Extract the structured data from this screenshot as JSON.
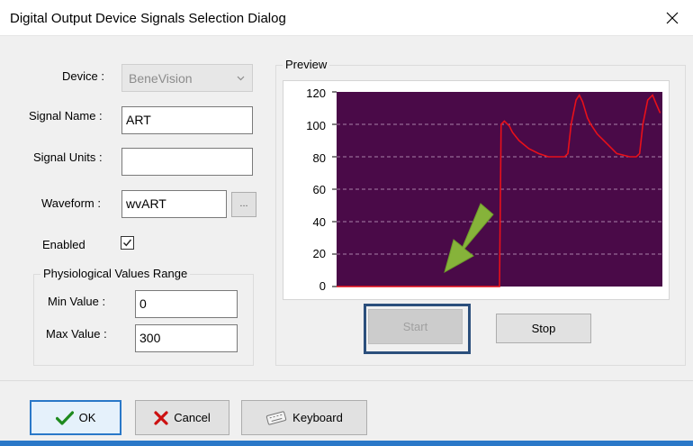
{
  "window": {
    "title": "Digital Output Device Signals Selection Dialog"
  },
  "device": {
    "label": "Device :",
    "value": "BeneVision"
  },
  "signal_name": {
    "label": "Signal Name :",
    "value": "ART"
  },
  "signal_units": {
    "label": "Signal Units :",
    "value": ""
  },
  "waveform": {
    "label": "Waveform :",
    "value": "wvART",
    "browse_label": "..."
  },
  "enabled": {
    "label": "Enabled",
    "checked": true
  },
  "range": {
    "title": "Physiological Values Range",
    "min_label": "Min Value :",
    "min_value": "0",
    "max_label": "Max Value :",
    "max_value": "300"
  },
  "preview": {
    "title": "Preview",
    "start_label": "Start",
    "stop_label": "Stop"
  },
  "buttons": {
    "ok": "OK",
    "cancel": "Cancel",
    "keyboard": "Keyboard"
  },
  "colors": {
    "plot_bg": "#4a0a48",
    "trace": "#e8101a",
    "arrow": "#86b33a",
    "highlight": "#2b4f7c"
  },
  "chart_data": {
    "type": "line",
    "ylim": [
      0,
      120
    ],
    "yticks": [
      "120",
      "100",
      "80",
      "60",
      "40",
      "20",
      "0"
    ],
    "xlim": [
      0,
      100
    ],
    "grid": true,
    "series": [
      {
        "x": [
          0,
          50,
          50.5,
          51.5,
          53,
          54,
          56,
          59,
          62,
          65,
          70,
          71,
          72,
          73.5,
          74.5,
          75.5,
          77,
          78,
          80,
          83,
          86,
          90,
          92,
          93,
          94,
          95.5,
          97,
          98,
          99.3
        ],
        "y": [
          0,
          0,
          100,
          102,
          99,
          95,
          90,
          85,
          82,
          80,
          80,
          82,
          100,
          115,
          118,
          114,
          104,
          100,
          94,
          88,
          82,
          80,
          80,
          82,
          100,
          115,
          118,
          113,
          107
        ]
      }
    ]
  }
}
